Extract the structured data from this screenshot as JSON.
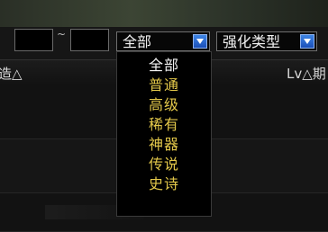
{
  "filter": {
    "level_min_value": "",
    "level_max_value": "",
    "range_separator": "~",
    "grade_select": {
      "selected": "全部"
    },
    "enhance_select": {
      "selected": "强化类型"
    }
  },
  "table": {
    "headers": {
      "left": "造△",
      "right": "Lv△期"
    }
  },
  "grade_dropdown": {
    "options": [
      "全部",
      "普通",
      "高级",
      "稀有",
      "神器",
      "传说",
      "史诗"
    ],
    "selected_index": 0
  }
}
